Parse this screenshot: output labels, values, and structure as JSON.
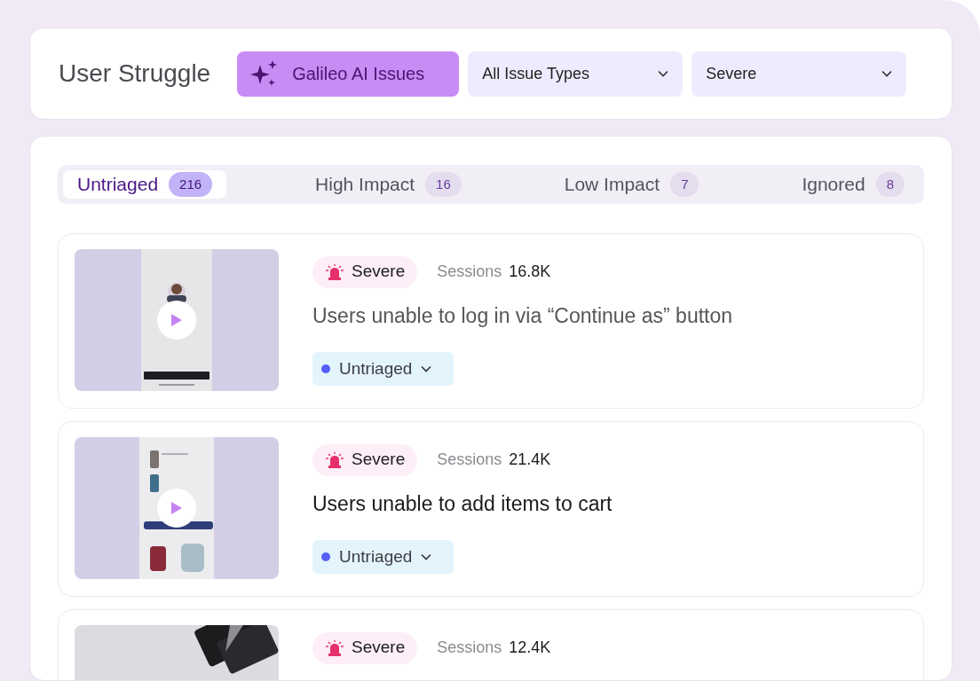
{
  "header": {
    "title": "User Struggle",
    "ai_button": "Galileo AI Issues",
    "filters": [
      {
        "value": "All Issue Types"
      },
      {
        "value": "Severe"
      }
    ]
  },
  "tabs": [
    {
      "label": "Untriaged",
      "count": "216",
      "selected": true
    },
    {
      "label": "High Impact",
      "count": "16",
      "selected": false
    },
    {
      "label": "Low Impact",
      "count": "7",
      "selected": false
    },
    {
      "label": "Ignored",
      "count": "8",
      "selected": false
    }
  ],
  "issues": [
    {
      "severity": "Severe",
      "sessions_label": "Sessions",
      "sessions": "16.8K",
      "title": "Users unable to log in via “Continue as” button",
      "viewed": true,
      "playable": true,
      "status": "Untriaged"
    },
    {
      "severity": "Severe",
      "sessions_label": "Sessions",
      "sessions": "21.4K",
      "title": "Users unable to add items to cart",
      "viewed": false,
      "playable": true,
      "status": "Untriaged"
    },
    {
      "severity": "Severe",
      "sessions_label": "Sessions",
      "sessions": "12.4K",
      "playable": false
    }
  ]
}
